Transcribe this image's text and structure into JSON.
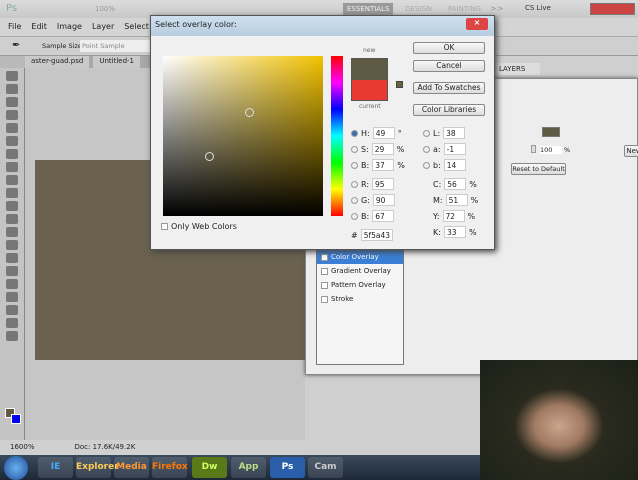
{
  "app": {
    "logo": "Ps",
    "zoom_menu": "100%",
    "workspaces": [
      "ESSENTIALS",
      "DESIGN",
      "PAINTING"
    ],
    "more": ">>",
    "cslive": "CS Live"
  },
  "menu": [
    "File",
    "Edit",
    "Image",
    "Layer",
    "Select",
    "Fi"
  ],
  "options": {
    "sample_size_label": "Sample Size:",
    "sample_size_value": "Point Sample"
  },
  "doc_tabs": [
    "aster-guad.psd",
    "Untitled-1"
  ],
  "status": {
    "zoom": "1600%",
    "doc": "Doc: 17.6K/49.2K"
  },
  "layers_panel": {
    "tab": "LAYERS"
  },
  "layer_style": {
    "opacity": "100",
    "opacity_unit": "%",
    "reset": "Reset to Default",
    "new_btn": "New",
    "overlay_color": "#5f5a43",
    "styles": [
      {
        "label": "Color Overlay",
        "checked": true,
        "selected": true
      },
      {
        "label": "Gradient Overlay",
        "checked": false
      },
      {
        "label": "Pattern Overlay",
        "checked": false
      },
      {
        "label": "Stroke",
        "checked": false
      }
    ]
  },
  "picker": {
    "title": "Select overlay color:",
    "new_label": "new",
    "current_label": "current",
    "new_color": "#5f5a43",
    "current_color": "#e83a30",
    "ok": "OK",
    "cancel": "Cancel",
    "add_swatches": "Add To Swatches",
    "libraries": "Color Libraries",
    "web_only": "Only Web Colors",
    "H": "49",
    "S": "29",
    "B": "37",
    "R": "95",
    "G": "90",
    "Bl": "67",
    "L": "38",
    "a": "-1",
    "b": "14",
    "C": "56",
    "M": "51",
    "Y": "72",
    "K": "33",
    "hex": "5f5a43",
    "deg": "°",
    "pct": "%"
  },
  "taskbar": [
    "IE",
    "Explorer",
    "Media",
    "Firefox",
    "Dw",
    "App",
    "Ps",
    "Cam"
  ]
}
